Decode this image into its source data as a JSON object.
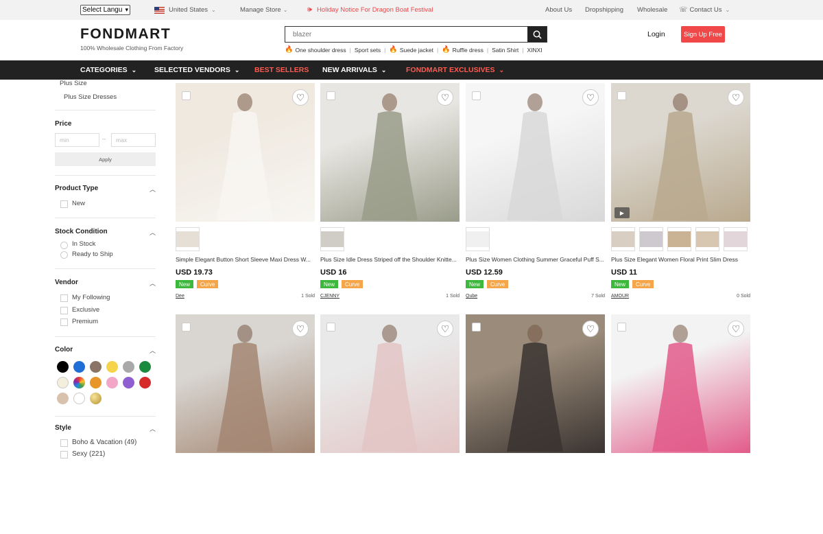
{
  "topbar": {
    "language_select": "Select Langu",
    "country": "United States",
    "manage_store": "Manage Store",
    "notice": "Holiday Notice For Dragon Boat Festival",
    "links": [
      "About Us",
      "Dropshipping",
      "Wholesale"
    ],
    "contact": "Contact Us"
  },
  "header": {
    "logo": "FONDMART",
    "tagline": "100% Wholesale Clothing From Factory",
    "search_placeholder": "blazer",
    "hot_searches": [
      "One shoulder dress",
      "Sport sets",
      "Suede jacket",
      "Ruffle dress",
      "Satin Shirt",
      "XINXI"
    ],
    "login": "Login",
    "signup": "Sign Up Free"
  },
  "nav": {
    "categories": "CATEGORIES",
    "selected_vendors": "SELECTED VENDORS",
    "best_sellers": "BEST SELLERS",
    "new_arrivals": "NEW ARRIVALS",
    "exclusives": "FONDMART EXCLUSIVES"
  },
  "sidebar": {
    "category_parent": "Plus Size",
    "category_child": "Plus Size Dresses",
    "price": {
      "title": "Price",
      "min": "min",
      "sep": "--",
      "max": "max",
      "apply": "Apply"
    },
    "product_type": {
      "title": "Product Type",
      "options": [
        "New"
      ]
    },
    "stock": {
      "title": "Stock Condition",
      "options": [
        "In Stock",
        "Ready to Ship"
      ]
    },
    "vendor": {
      "title": "Vendor",
      "options": [
        "My Following",
        "Exclusive",
        "Premium"
      ]
    },
    "color": {
      "title": "Color",
      "swatches": [
        "#000000",
        "#1f6fd6",
        "#8b7366",
        "#f5d34a",
        "#a9a9a9",
        "#1a8a3e",
        "#f3efdc",
        "multi",
        "#e8962a",
        "#f2a7c9",
        "#8d5fd0",
        "#d62a2a",
        "#d9c2ad",
        "#ffffff",
        "gold"
      ]
    },
    "style": {
      "title": "Style",
      "options": [
        "Boho & Vacation (49)",
        "Sexy (221)"
      ]
    }
  },
  "products": [
    {
      "title": "Simple Elegant Button Short Sleeve Maxi Dress W...",
      "price": "USD 19.73",
      "tags": [
        "New",
        "Curve"
      ],
      "vendor": "Dee",
      "sold": "1 Sold",
      "img": [
        "#efe9e0",
        "#f8f6f2"
      ],
      "thumbs": [
        "#e5dfd6"
      ],
      "video": false
    },
    {
      "title": "Plus Size Idle Dress Striped off the Shoulder Knitte...",
      "price": "USD 16",
      "tags": [
        "New",
        "Curve"
      ],
      "vendor": "CJENNY",
      "sold": "1 Sold",
      "img": [
        "#e8e6e2",
        "#9a9c8a"
      ],
      "thumbs": [
        "#cfcdc5"
      ],
      "video": false
    },
    {
      "title": "Plus Size Women Clothing Summer Graceful Puff S...",
      "price": "USD 12.59",
      "tags": [
        "New",
        "Curve"
      ],
      "vendor": "Qube",
      "sold": "7 Sold",
      "img": [
        "#f6f6f6",
        "#d8d8d8"
      ],
      "thumbs": [
        "#f0f0f0"
      ],
      "video": false
    },
    {
      "title": "Plus Size Elegant Women Floral Print Slim Dress",
      "price": "USD 11",
      "tags": [
        "New",
        "Curve"
      ],
      "vendor": "AMOUR",
      "sold": "0 Sold",
      "img": [
        "#dcd8d0",
        "#b9a98e"
      ],
      "thumbs": [
        "#d8cfc2",
        "#cdc9cf",
        "#c9b394",
        "#d7c6b0",
        "#e3d6da"
      ],
      "video": true
    },
    {
      "title": "",
      "price": "",
      "tags": [],
      "vendor": "",
      "sold": "",
      "img": [
        "#d9d6d2",
        "#a38672"
      ],
      "thumbs": [],
      "video": false
    },
    {
      "title": "",
      "price": "",
      "tags": [],
      "vendor": "",
      "sold": "",
      "img": [
        "#e9e9e9",
        "#e3c4c4"
      ],
      "thumbs": [],
      "video": false
    },
    {
      "title": "",
      "price": "",
      "tags": [],
      "vendor": "",
      "sold": "",
      "img": [
        "#9a8b7a",
        "#3a3330"
      ],
      "thumbs": [],
      "video": false
    },
    {
      "title": "",
      "price": "",
      "tags": [],
      "vendor": "",
      "sold": "",
      "img": [
        "#f3f3f3",
        "#e25b8a"
      ],
      "thumbs": [],
      "video": false
    }
  ]
}
